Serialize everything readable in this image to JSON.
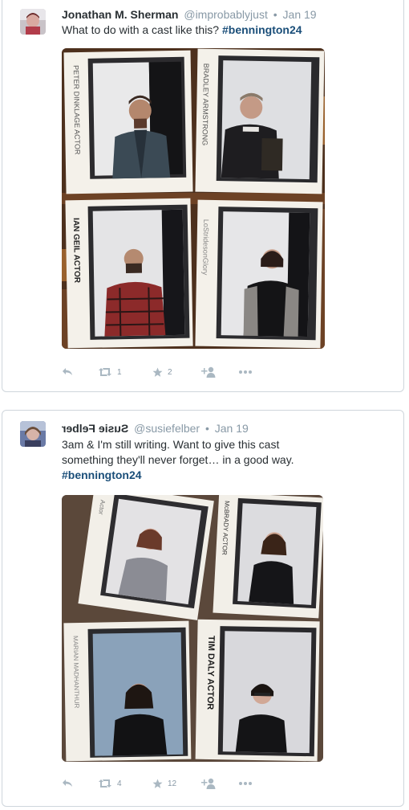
{
  "tweets": [
    {
      "fullname": "Jonathan M. Sherman",
      "screenname": "@improbablyjust",
      "separator": "•",
      "date": "Jan 19",
      "text_lines": [
        "What to do with a cast like this? "
      ],
      "hashtag": "#bennington24",
      "retweet_count": "1",
      "favorite_count": "2",
      "photo_captions": [
        "PETER DINKLAGE ACTOR",
        "BRADLEY ARMSTRONG",
        "IAN GEIL ACTOR",
        "LoStridesonGlory"
      ]
    },
    {
      "fullname": "Susie Felber",
      "screenname": "@susiefelber",
      "separator": "•",
      "date": "Jan 19",
      "text_lines": [
        "3am & I'm still writing. Want to give this cast",
        "something they'll never forget… in a good way."
      ],
      "hashtag": "#bennington24",
      "retweet_count": "4",
      "favorite_count": "12",
      "photo_captions": [
        "TIM DALY ACTOR",
        "MARIAN MADHANTHUR",
        "ACTOR"
      ]
    }
  ],
  "icons": {
    "reply": "reply-icon",
    "retweet": "retweet-icon",
    "favorite": "star-icon",
    "follow": "follow-icon",
    "more": "more-icon"
  },
  "colors": {
    "hashtag": "#1a4e79",
    "muted": "#8899a6",
    "border": "#cfd6dc"
  }
}
